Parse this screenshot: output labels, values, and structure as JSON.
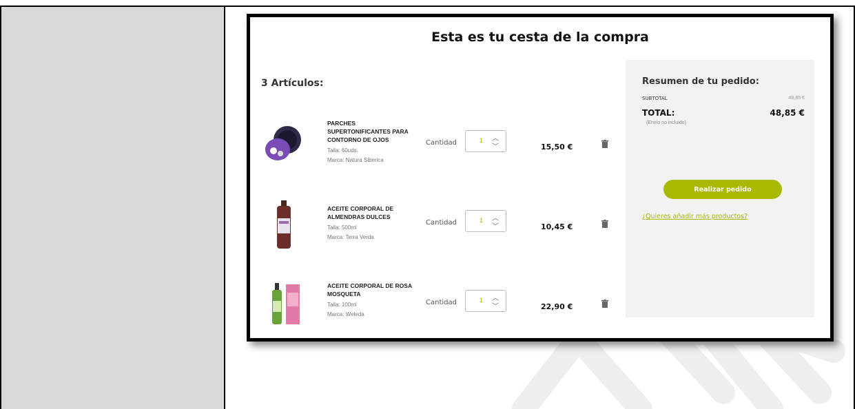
{
  "cart": {
    "title": "Esta es tu cesta de la compra",
    "items_count": "3 Artículos:",
    "items": [
      {
        "name": "PARCHES SUPERTONIFICANTES PARA CONTORNO DE OJOS",
        "size": "Talla: 60uds.",
        "brand": "Marca: Natura Siberica",
        "qty_label": "Cantidad",
        "qty": "1",
        "price": "15,50 €"
      },
      {
        "name": "ACEITE CORPORAL DE ALMENDRAS DULCES",
        "size": "Talla: 500ml",
        "brand": "Marca: Terra Verda",
        "qty_label": "Cantidad",
        "qty": "1",
        "price": "10,45 €"
      },
      {
        "name": "ACEITE CORPORAL DE ROSA MOSQUETA",
        "size": "Talla: 100ml",
        "brand": "Marca: Weleda",
        "qty_label": "Cantidad",
        "qty": "1",
        "price": "22,90 €"
      }
    ]
  },
  "summary": {
    "title": "Resumen de tu pedido:",
    "subtotal_label": "SUBTOTAL",
    "subtotal_value": "48,85 €",
    "total_label": "TOTAL:",
    "total_value": "48,85 €",
    "shipping_note": "(Envío no incluido)",
    "order_button": "Realizar pedido",
    "more_products_link": "¿Quieres añadir más productos?"
  },
  "icons": {
    "stepper_up": "chevron-up-icon",
    "stepper_down": "chevron-down-icon",
    "delete": "trash-icon"
  },
  "colors": {
    "accent": "#a9b800",
    "summary_bg": "#f2f2f2",
    "sidebar_bg": "#d9d9d9"
  }
}
